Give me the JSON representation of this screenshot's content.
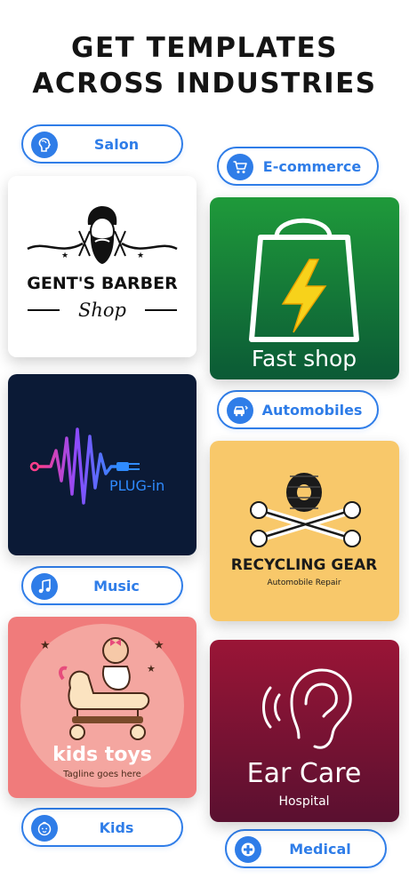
{
  "headline": {
    "line1": "GET TEMPLATES",
    "line2": "ACROSS INDUSTRIES"
  },
  "categories": {
    "salon": {
      "label": "Salon",
      "icon": "hair-profile-icon"
    },
    "ecommerce": {
      "label": "E-commerce",
      "icon": "shopping-cart-icon"
    },
    "automobiles": {
      "label": "Automobiles",
      "icon": "car-service-icon"
    },
    "music": {
      "label": "Music",
      "icon": "music-note-icon"
    },
    "kids": {
      "label": "Kids",
      "icon": "baby-face-icon"
    },
    "medical": {
      "label": "Medical",
      "icon": "medical-cross-icon"
    }
  },
  "templates": {
    "barber": {
      "name": "GENT'S BARBER",
      "sub": "Shop",
      "bg": "#ffffff"
    },
    "fastshop": {
      "name": "Fast shop",
      "bg": "#0e7a3a"
    },
    "plugin": {
      "name": "PLUG-in",
      "bg": "#0b1a36"
    },
    "recycling": {
      "name": "RECYCLING GEAR",
      "sub": "Automobile Repair",
      "bg": "#f8c86a"
    },
    "kidstoys": {
      "name": "kids toys",
      "sub": "Tagline goes here",
      "bg": "#f07b7b"
    },
    "earcare": {
      "name": "Ear Care",
      "sub": "Hospital",
      "bg": "#7e1436"
    }
  },
  "colors": {
    "accent": "#2f7de8",
    "headline": "#141414"
  }
}
